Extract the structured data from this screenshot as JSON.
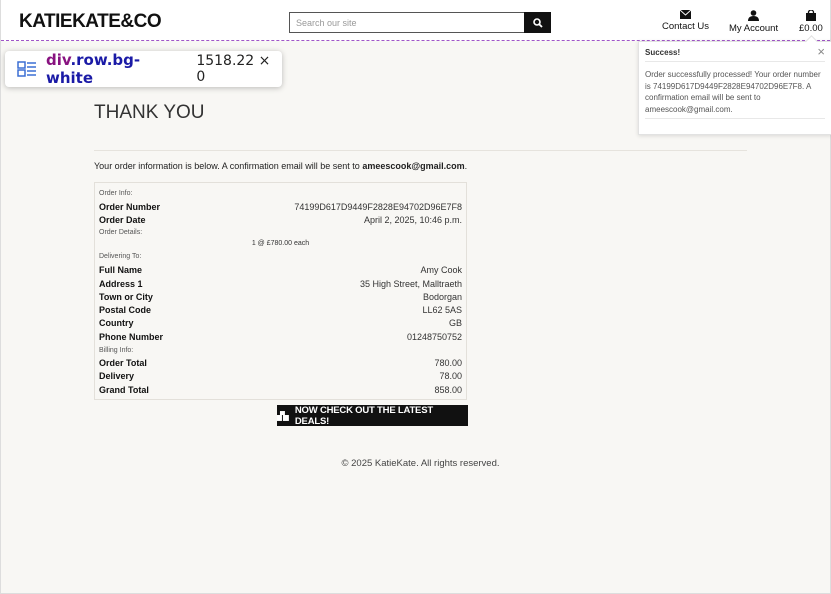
{
  "header": {
    "logo": "KATIEKATE&CO",
    "search_placeholder": "Search our site",
    "contact_label": "Contact Us",
    "account_label": "My Account",
    "bag_total": "£0.00"
  },
  "devtools": {
    "tag": "div",
    "classes": ".row.bg-white",
    "dimensions": "1518.22 × 0"
  },
  "toast": {
    "title": "Success!",
    "message": "Order successfully processed! Your order number is 74199D617D9449F2828E94702D96E7F8. A confirmation email will be sent to ameescook@gmail.com."
  },
  "page": {
    "title": "THANK YOU",
    "intro_prefix": "Your order information is below. A confirmation email will be sent to ",
    "intro_email": "ameescook@gmail.com",
    "intro_suffix": "."
  },
  "order": {
    "order_info_heading": "Order Info:",
    "order_number_label": "Order Number",
    "order_number": "74199D617D9449F2828E94702D96E7F8",
    "order_date_label": "Order Date",
    "order_date": "April 2, 2025, 10:46 p.m.",
    "order_details_heading": "Order Details:",
    "line_item": "1 @ £780.00 each",
    "delivering_heading": "Delivering To:",
    "full_name_label": "Full Name",
    "full_name": "Amy Cook",
    "address1_label": "Address 1",
    "address1": "35 High Street, Malltraeth",
    "town_label": "Town or City",
    "town": "Bodorgan",
    "postcode_label": "Postal Code",
    "postcode": "LL62 5AS",
    "country_label": "Country",
    "country": "GB",
    "phone_label": "Phone Number",
    "phone": "01248750752",
    "billing_heading": "Billing Info:",
    "order_total_label": "Order Total",
    "order_total": "780.00",
    "delivery_label": "Delivery",
    "delivery": "78.00",
    "grand_total_label": "Grand Total",
    "grand_total": "858.00"
  },
  "cta_label": "NOW CHECK OUT THE LATEST DEALS!",
  "footer": "© 2025 KatieKate. All rights reserved."
}
